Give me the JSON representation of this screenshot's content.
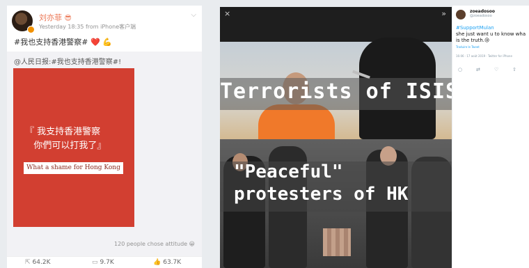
{
  "weibo": {
    "username": "刘亦菲",
    "name_emoji": "😎",
    "meta": "Yesterday 18:35  from iPhone客户端",
    "post_text": "#我也支持香港警察#",
    "post_emojis": [
      "❤️",
      "💪"
    ],
    "repost_text": "@人民日报:#我也支持香港警察#!",
    "card_text": "『 我支持香港警察\n   你們可以打我了』",
    "card_caption": "What a shame for Hong Kong",
    "attitude_text": "120 people chose attitude",
    "attitude_emoji": "😀",
    "actions": [
      {
        "icon": "share-icon",
        "count": "64.2K"
      },
      {
        "icon": "comment-icon",
        "count": "9.7K"
      },
      {
        "icon": "like-icon",
        "count": "63.7K"
      }
    ],
    "accent_color": "#eb7350",
    "card_color": "#d23f31"
  },
  "meme": {
    "close_glyph": "×",
    "forward_glyph": "»",
    "caption_top": "Terrorists of ISIS",
    "caption_bottom_line1": "\"Peaceful\"",
    "caption_bottom_line2": "protesters of HK"
  },
  "tweet": {
    "name": "zoeadosoo",
    "handle": "@zoeadosoo",
    "hashtag": "#SupportMulan",
    "text": "she just want u to know wha\nis the truth.😢",
    "translate": "Traduire le Tweet",
    "time": "16:06 · 17 août 2019 · Twitter for iPhone",
    "accent_color": "#1da1f2"
  }
}
